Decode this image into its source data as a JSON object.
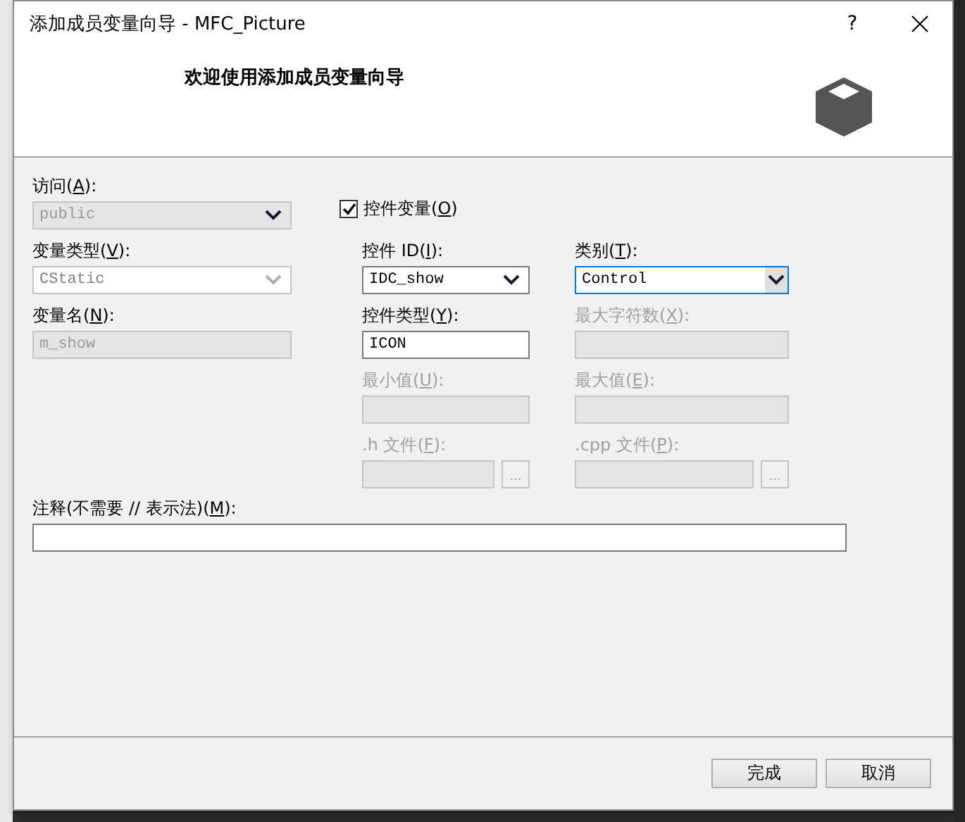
{
  "window": {
    "title": "添加成员变量向导 - MFC_Picture",
    "help": "?"
  },
  "header": {
    "heading": "欢迎使用添加成员变量向导"
  },
  "left": [
    {
      "kind": "combo",
      "label": {
        "pre": "访问(",
        "key": "A",
        "post": "):",
        "disabled": false
      },
      "value": "public",
      "disabled": true
    },
    {
      "kind": "combo-edit",
      "label": {
        "pre": "变量类型(",
        "key": "V",
        "post": "):",
        "disabled": false
      },
      "value": "CStatic",
      "disabled": true
    },
    {
      "kind": "text",
      "label": {
        "pre": "变量名(",
        "key": "N",
        "post": "):",
        "disabled": false
      },
      "value": "m_show",
      "disabled": true
    }
  ],
  "control_variable": {
    "label": {
      "pre": "控件变量(",
      "key": "O",
      "post": ")"
    },
    "checked": true
  },
  "middle": [
    {
      "kind": "combo",
      "label": {
        "pre": "控件 ID(",
        "key": "I",
        "post": "):",
        "disabled": false
      },
      "value": "IDC_show",
      "disabled": false,
      "focused": false
    },
    {
      "kind": "text",
      "label": {
        "pre": "控件类型(",
        "key": "Y",
        "post": "):",
        "disabled": false
      },
      "value": "ICON",
      "disabled": false
    },
    {
      "kind": "text",
      "label": {
        "pre": "最小值(",
        "key": "U",
        "post": "):",
        "disabled": true
      },
      "disabled": true
    },
    {
      "kind": "file",
      "label": {
        "pre": ".h 文件(",
        "key": "F",
        "post": "):",
        "disabled": true
      },
      "disabled": true,
      "browse": "..."
    }
  ],
  "right": [
    {
      "kind": "combo",
      "label": {
        "pre": "类别(",
        "key": "T",
        "post": "):",
        "disabled": false
      },
      "value": "Control",
      "disabled": false,
      "focused": true
    },
    {
      "kind": "text",
      "label": {
        "pre": "最大字符数(",
        "key": "X",
        "post": "):",
        "disabled": true
      },
      "disabled": true
    },
    {
      "kind": "text",
      "label": {
        "pre": "最大值(",
        "key": "E",
        "post": "):",
        "disabled": true
      },
      "disabled": true
    },
    {
      "kind": "file",
      "label": {
        "pre": ".cpp 文件(",
        "key": "P",
        "post": "):",
        "disabled": true
      },
      "disabled": true,
      "browse": "..."
    }
  ],
  "comment": {
    "kind": "text",
    "label": {
      "pre": "注释(不需要 // 表示法)(",
      "key": "M",
      "post": "):",
      "disabled": false
    },
    "disabled": false
  },
  "buttons": [
    {
      "label": "完成"
    },
    {
      "label": "取消"
    }
  ]
}
